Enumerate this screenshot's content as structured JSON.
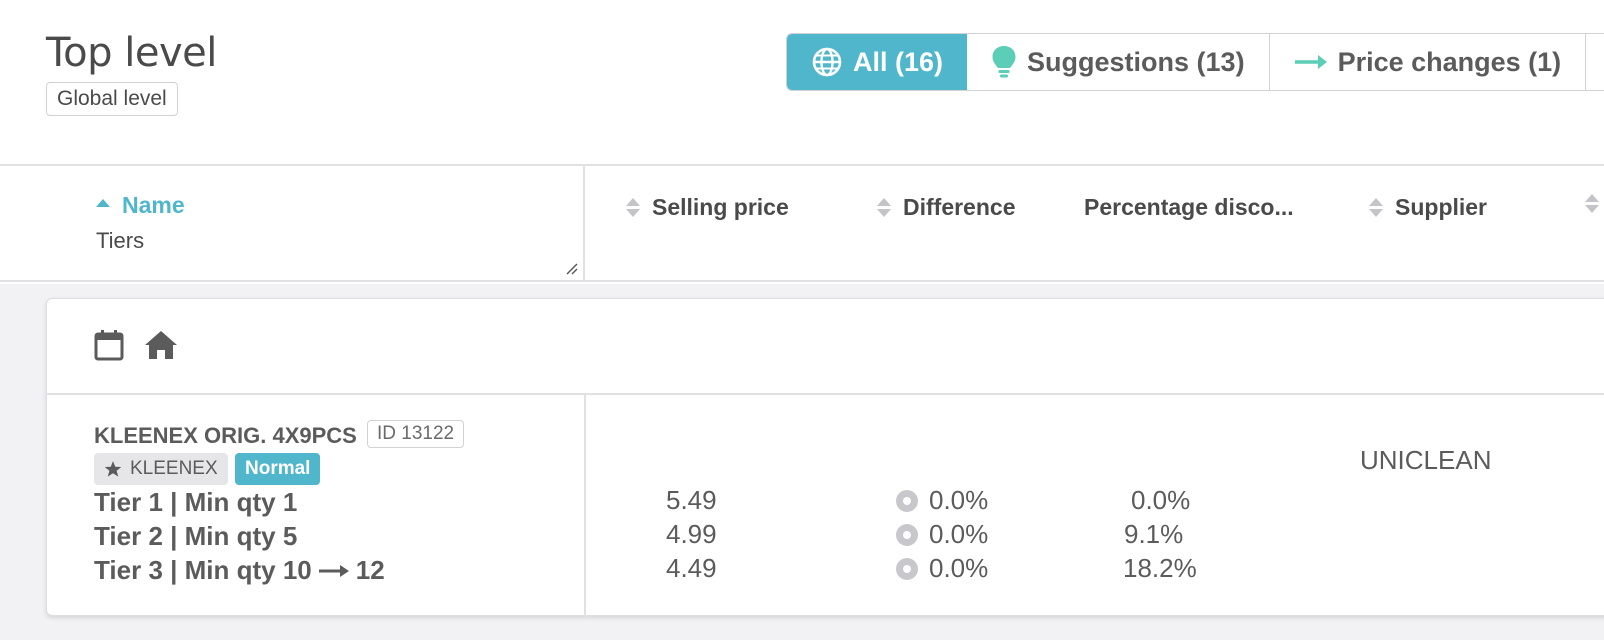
{
  "header": {
    "title": "Top level",
    "level_badge": "Global level",
    "filters": [
      {
        "label": "All (16)",
        "icon": "globe-icon",
        "active": true
      },
      {
        "label": "Suggestions (13)",
        "icon": "lightbulb-icon",
        "active": false
      },
      {
        "label": "Price changes (1)",
        "icon": "arrow-right-icon",
        "active": false
      }
    ]
  },
  "table": {
    "columns": {
      "name": "Name",
      "name_sub": "Tiers",
      "selling_price": "Selling price",
      "difference": "Difference",
      "percentage_discount": "Percentage disco...",
      "supplier": "Supplier"
    }
  },
  "card": {
    "icons": [
      "calendar-icon",
      "home-icon"
    ],
    "product": {
      "name": "KLEENEX ORIG. 4X9PCS",
      "id": "ID 13122",
      "brand": "KLEENEX",
      "status": "Normal",
      "supplier": "UNICLEAN"
    },
    "tiers": [
      {
        "label": "Tier 1 | Min qty 1",
        "new_qty": "",
        "price": "5.49",
        "difference": "0.0%",
        "discount": "0.0%"
      },
      {
        "label": "Tier 2 | Min qty 5",
        "new_qty": "",
        "price": "4.99",
        "difference": "0.0%",
        "discount": "9.1%"
      },
      {
        "label": "Tier 3 | Min qty 10",
        "new_qty": "12",
        "price": "4.49",
        "difference": "0.0%",
        "discount": "18.2%"
      }
    ]
  },
  "colors": {
    "accent": "#4fb6cb",
    "suggestion": "#5ccdb6",
    "text": "#4a4a4a",
    "body_bg": "#f2f2f5"
  }
}
